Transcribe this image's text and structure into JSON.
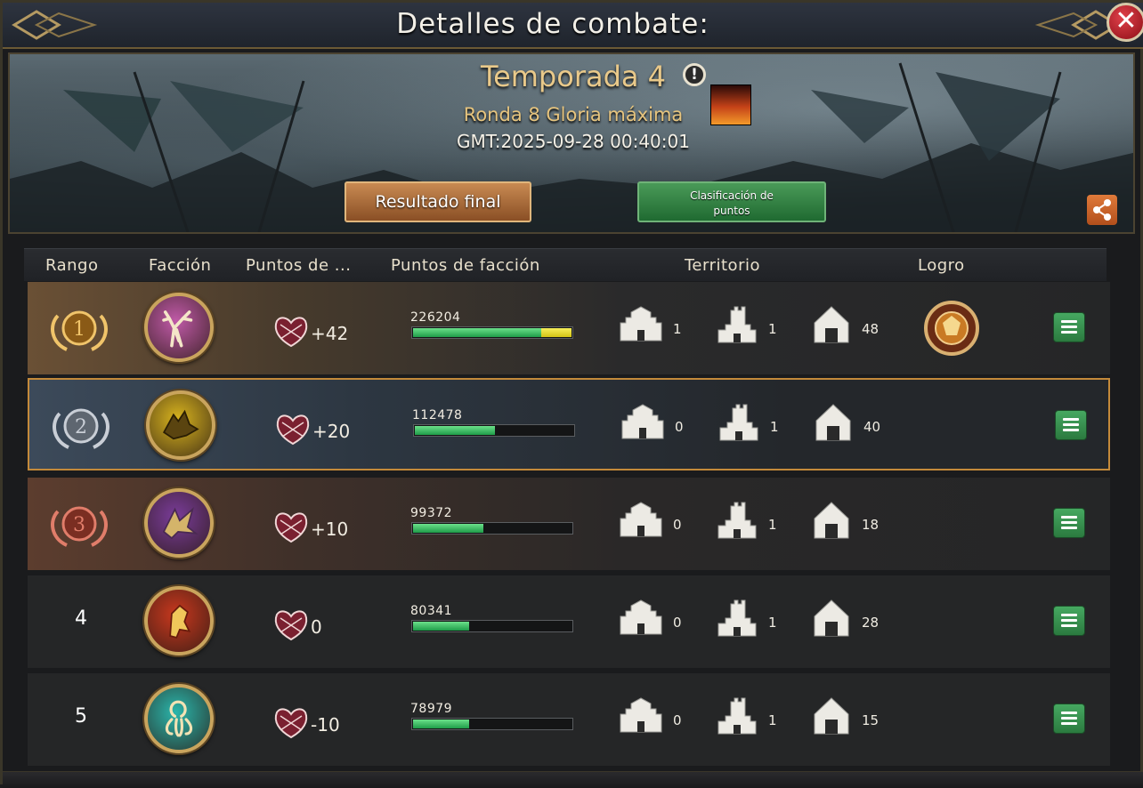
{
  "window": {
    "title": "Detalles de combate:",
    "close_label": "✕"
  },
  "banner": {
    "season": "Temporada 4",
    "info_icon": "!",
    "round": "Ronda 8 Gloria máxima",
    "gmt": "GMT:2025-09-28 00:40:01",
    "btn_final": "Resultado final",
    "btn_points_line1": "Clasificación de",
    "btn_points_line2": "puntos"
  },
  "table": {
    "headers": {
      "rank": "Rango",
      "faction": "Facción",
      "points": "Puntos de ...",
      "faction_points": "Puntos de facción",
      "territory": "Territorio",
      "achievement": "Logro"
    },
    "rows": [
      {
        "rank": "1",
        "crest": "stag-crest",
        "crest_color": "#c05aa8",
        "points": "+42",
        "faction_points": "226204",
        "progress_green": 0.8,
        "progress_yellow": 0.2,
        "t1": "1",
        "t2": "1",
        "t3": "48",
        "has_achievement": true
      },
      {
        "rank": "2",
        "crest": "direwolf-crest",
        "crest_color": "#d8b41e",
        "points": "+20",
        "faction_points": "112478",
        "progress_green": 0.5,
        "progress_yellow": 0,
        "t1": "0",
        "t2": "1",
        "t3": "40",
        "has_achievement": false
      },
      {
        "rank": "3",
        "crest": "dragon-crest",
        "crest_color": "#7a3c9a",
        "points": "+10",
        "faction_points": "99372",
        "progress_green": 0.44,
        "progress_yellow": 0,
        "t1": "0",
        "t2": "1",
        "t3": "18",
        "has_achievement": false
      },
      {
        "rank": "4",
        "crest": "lion-crest",
        "crest_color": "#c8381e",
        "points": "0",
        "faction_points": "80341",
        "progress_green": 0.35,
        "progress_yellow": 0,
        "t1": "0",
        "t2": "1",
        "t3": "28",
        "has_achievement": false
      },
      {
        "rank": "5",
        "crest": "kraken-crest",
        "crest_color": "#2ab6ac",
        "points": "-10",
        "faction_points": "78979",
        "progress_green": 0.35,
        "progress_yellow": 0,
        "t1": "0",
        "t2": "1",
        "t3": "15",
        "has_achievement": false
      }
    ]
  }
}
